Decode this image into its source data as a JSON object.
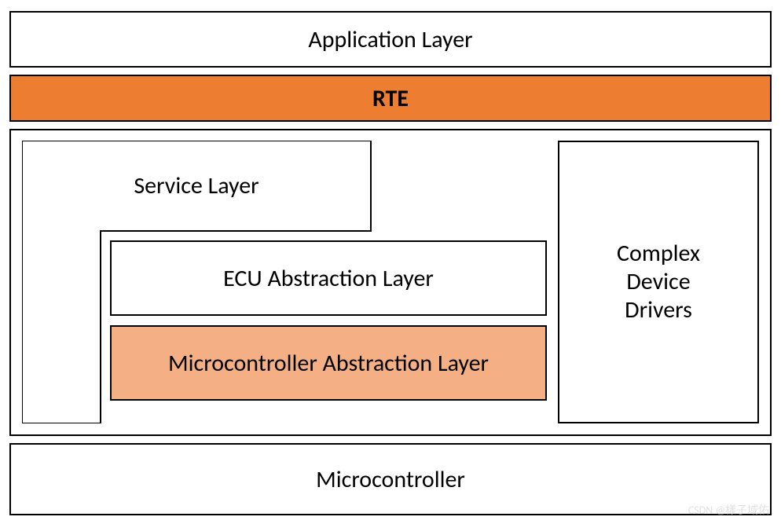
{
  "layers": {
    "application": "Application Layer",
    "rte": "RTE",
    "service": "Service Layer",
    "ecu_abstraction": "ECU Abstraction Layer",
    "mcal": "Microcontroller Abstraction Layer",
    "complex_drivers_line1": "Complex",
    "complex_drivers_line2": "Device",
    "complex_drivers_line3": "Drivers",
    "microcontroller": "Microcontroller"
  },
  "colors": {
    "rte_bg": "#ED7D31",
    "mcal_bg": "#F4B084",
    "border": "#000000"
  },
  "watermark": "CSDN @樣子域佑"
}
